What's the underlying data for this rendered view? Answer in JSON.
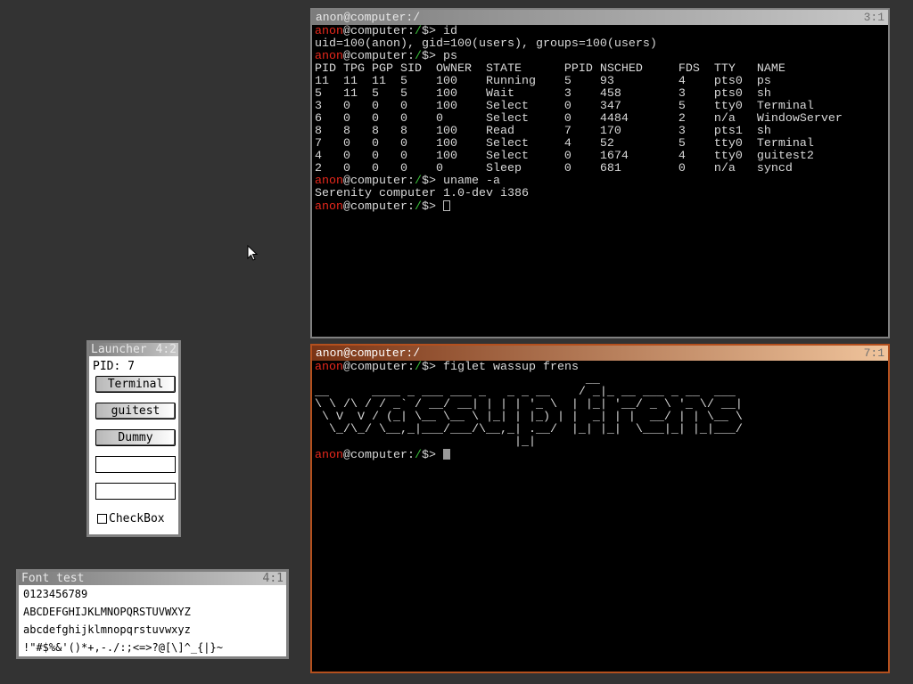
{
  "terminal1": {
    "title": "anon@computer:/",
    "id": "3:1",
    "prompt": {
      "user": "anon",
      "host": "@computer:",
      "path": "/",
      "suffix": "$> "
    },
    "lines": [
      {
        "type": "prompt",
        "cmd": "id"
      },
      {
        "type": "out",
        "text": "uid=100(anon), gid=100(users), groups=100(users)"
      },
      {
        "type": "prompt",
        "cmd": "ps"
      },
      {
        "type": "out",
        "text": "PID TPG PGP SID  OWNER  STATE      PPID NSCHED     FDS  TTY   NAME"
      },
      {
        "type": "out",
        "text": "11  11  11  5    100    Running    5    93         4    pts0  ps"
      },
      {
        "type": "out",
        "text": "5   11  5   5    100    Wait       3    458        3    pts0  sh"
      },
      {
        "type": "out",
        "text": "3   0   0   0    100    Select     0    347        5    tty0  Terminal"
      },
      {
        "type": "out",
        "text": "6   0   0   0    0      Select     0    4484       2    n/a   WindowServer"
      },
      {
        "type": "out",
        "text": "8   8   8   8    100    Read       7    170        3    pts1  sh"
      },
      {
        "type": "out",
        "text": "7   0   0   0    100    Select     4    52         5    tty0  Terminal"
      },
      {
        "type": "out",
        "text": "4   0   0   0    100    Select     0    1674       4    tty0  guitest2"
      },
      {
        "type": "out",
        "text": "2   0   0   0    0      Sleep      0    681        0    n/a   syncd"
      },
      {
        "type": "prompt",
        "cmd": "uname -a"
      },
      {
        "type": "out",
        "text": "Serenity computer 1.0-dev i386"
      },
      {
        "type": "prompt",
        "cmd": "",
        "cursor": "box"
      }
    ]
  },
  "terminal2": {
    "title": "anon@computer:/",
    "id": "7:1",
    "lines": [
      {
        "type": "prompt",
        "cmd": "figlet wassup frens"
      },
      {
        "type": "out",
        "text": "                                      __"
      },
      {
        "type": "out",
        "text": "__      ____ _ ___ ___ _   _ _ __    / _|_ __ ___ _ __  ___"
      },
      {
        "type": "out",
        "text": "\\ \\ /\\ / / _` / __/ __| | | | '_ \\  | |_| '__/ _ \\ '_ \\/ __|"
      },
      {
        "type": "out",
        "text": " \\ V  V / (_| \\__ \\__ \\ |_| | |_) | |  _| | |  __/ | | \\__ \\"
      },
      {
        "type": "out",
        "text": "  \\_/\\_/ \\__,_|___/___/\\__,_| .__/  |_| |_|  \\___|_| |_|___/"
      },
      {
        "type": "out",
        "text": "                            |_|"
      },
      {
        "type": "prompt",
        "cmd": "",
        "cursor": "fill"
      }
    ]
  },
  "launcher": {
    "title": "Launcher",
    "id": "4:2",
    "pid_label": "PID: 7",
    "buttons": [
      "Terminal",
      "guitest",
      "Dummy"
    ],
    "textboxes": [
      "",
      ""
    ],
    "checkbox": {
      "label": "CheckBox",
      "checked": false
    }
  },
  "fonttest": {
    "title": "Font test",
    "id": "4:1",
    "lines": [
      "0123456789",
      "ABCDEFGHIJKLMNOPQRSTUVWXYZ",
      "abcdefghijklmnopqrstuvwxyz",
      "!\"#$%&'()*+,-./:;<=>?@[\\]^_{|}~"
    ]
  },
  "colors": {
    "desktop": "#333333",
    "prompt_user": "#e8281c",
    "prompt_path": "#38c038",
    "active_border": "#b4501e"
  }
}
